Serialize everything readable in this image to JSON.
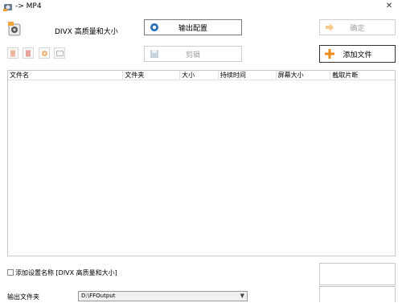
{
  "window": {
    "title": "-> MP4"
  },
  "preset": {
    "label": "DIVX 高质量和大小"
  },
  "buttons": {
    "output_config": "输出配置",
    "confirm": "确定",
    "clip": "剪辑",
    "add_file": "添加文件"
  },
  "file_list": {
    "columns": [
      "文件名",
      "文件夹",
      "大小",
      "持续时间",
      "屏幕大小",
      "截取片断"
    ],
    "rows": []
  },
  "add_setting_name": {
    "label": "添加设置名称 [DIVX 高质量和大小]",
    "checked": false
  },
  "output_folder": {
    "label": "输出文件夹",
    "value": "D:\\FFOutput"
  },
  "colors": {
    "accent_orange": "#f5a33a",
    "border": "#adadad",
    "disabled_text": "#a0a0a0"
  }
}
